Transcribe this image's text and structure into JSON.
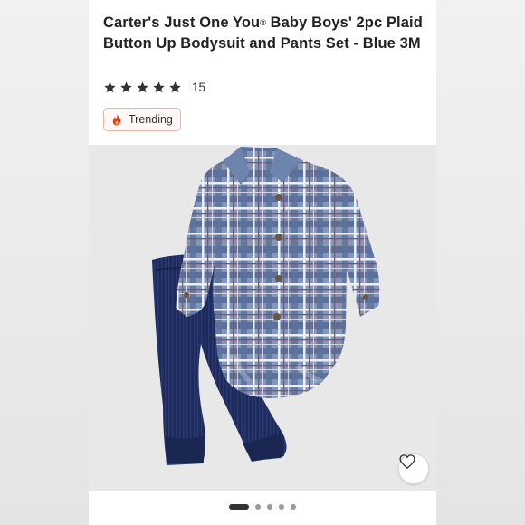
{
  "product": {
    "title_part1": "Carter's Just One You",
    "title_reg": "®",
    "title_part2": " Baby Boys' 2pc Plaid Button Up Bodysuit and Pants Set - Blue 3M",
    "rating": 5,
    "review_count": "15",
    "badge_label": "Trending",
    "badge_icon": "flame-icon"
  },
  "gallery": {
    "image_count": 5,
    "active_index": 0,
    "favorite_icon": "heart-outline-icon"
  },
  "colors": {
    "accent": "#cc0000",
    "star": "#333333",
    "badge_border": "#e7b5a3"
  }
}
